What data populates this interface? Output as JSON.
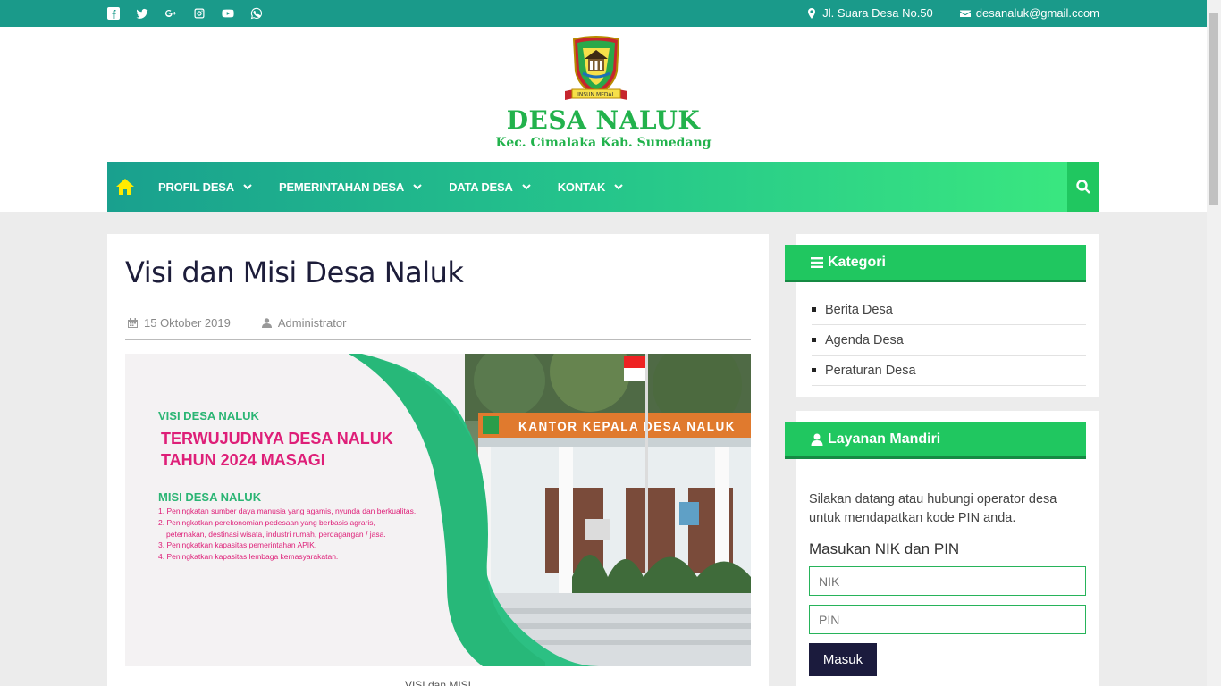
{
  "topbar": {
    "social_icons": [
      "facebook-icon",
      "twitter-icon",
      "google-plus-icon",
      "instagram-icon",
      "youtube-icon",
      "whatsapp-icon"
    ],
    "address": "Jl. Suara Desa No.50",
    "email": "desanaluk@gmail.ccom",
    "color": "#1a9a8a"
  },
  "header": {
    "title": "DESA NALUK",
    "subtitle": "Kec. Cimalaka Kab. Sumedang",
    "logo_text": "INSUN MEDAL",
    "brand_color": "#22b24c"
  },
  "nav": {
    "items": [
      {
        "label": "PROFIL DESA"
      },
      {
        "label": "PEMERINTAHAN DESA"
      },
      {
        "label": "DATA DESA"
      },
      {
        "label": "KONTAK"
      }
    ]
  },
  "post": {
    "title": "Visi dan Misi Desa Naluk",
    "date": "15 Oktober 2019",
    "author": "Administrator",
    "banner": {
      "visi_label": "VISI DESA NALUK",
      "visi_line1": "TERWUJUDNYA DESA NALUK",
      "visi_line2": "TAHUN 2024 MASAGI",
      "misi_label": "MISI DESA NALUK",
      "misi": [
        "1. Peningkatan sumber daya manusia yang agamis, nyunda dan berkualitas.",
        "2. Peningkatkan perekonomian pedesaan yang berbasis agraris,",
        "    peternakan, destinasi wisata, industri rumah, perdagangan / jasa.",
        "3. Peningkatkan kapasitas pemerintahan APIK.",
        "4. Peningkatkan kapasitas lembaga kemasyarakatan."
      ],
      "sign_text": "KANTOR KEPALA DESA NALUK"
    },
    "caption": "VISI dan MISI"
  },
  "sidebar": {
    "kategori": {
      "title": "Kategori",
      "items": [
        "Berita Desa",
        "Agenda Desa",
        "Peraturan Desa"
      ]
    },
    "layanan": {
      "title": "Layanan Mandiri",
      "desc": "Silakan datang atau hubungi operator desa untuk mendapatkan kode PIN anda.",
      "form_label": "Masukan NIK dan PIN",
      "nik_placeholder": "NIK",
      "pin_placeholder": "PIN",
      "button": "Masuk"
    }
  }
}
